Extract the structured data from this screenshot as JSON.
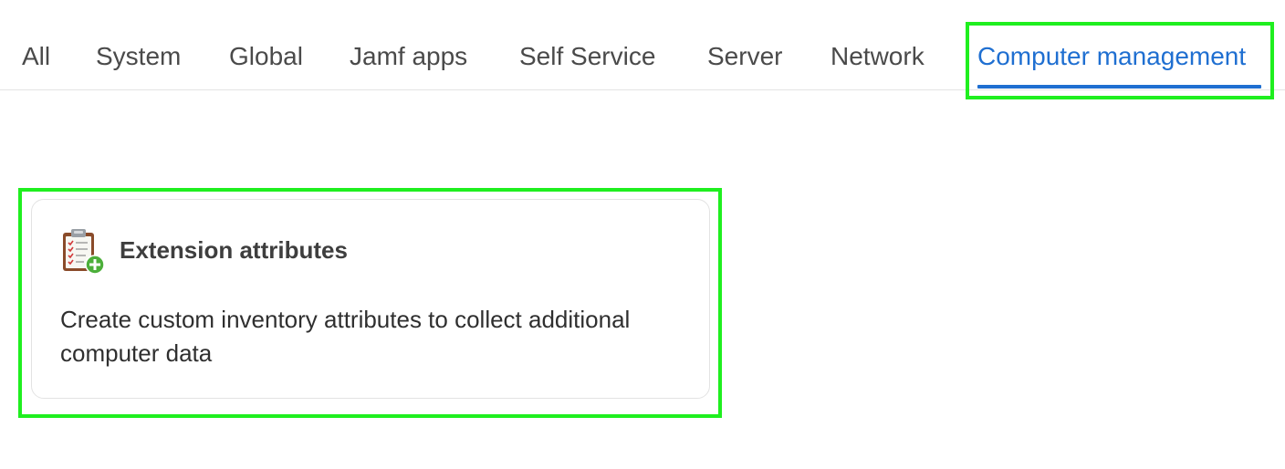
{
  "tabs": [
    {
      "label": "All"
    },
    {
      "label": "System"
    },
    {
      "label": "Global"
    },
    {
      "label": "Jamf apps"
    },
    {
      "label": "Self Service"
    },
    {
      "label": "Server"
    },
    {
      "label": "Network"
    },
    {
      "label": "Computer management",
      "active": true
    }
  ],
  "colors": {
    "active_tab": "#1f6fd1",
    "highlight": "#1fef1f",
    "text": "#4a4a4a"
  },
  "card": {
    "icon": "clipboard-add-icon",
    "title": "Extension attributes",
    "description": "Create custom inventory attributes to collect additional computer data"
  }
}
